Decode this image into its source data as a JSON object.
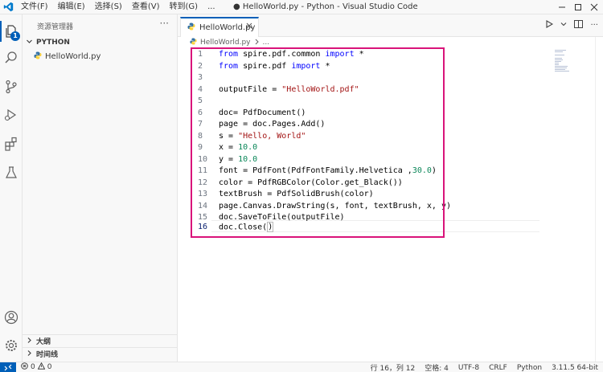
{
  "titlebar": {
    "menu": [
      "文件(F)",
      "编辑(E)",
      "选择(S)",
      "查看(V)",
      "转到(G)",
      "..."
    ],
    "title": "● HelloWorld.py - Python - Visual Studio Code"
  },
  "activity": {
    "explorer_badge": "1"
  },
  "sidebar": {
    "header": "资源管理器",
    "more": "···",
    "section": "PYTHON",
    "file": "HelloWorld.py",
    "outline": "大纲",
    "timeline": "时间线"
  },
  "editor": {
    "tab_label": "HelloWorld.py",
    "breadcrumb_file": "HelloWorld.py",
    "breadcrumb_more": "...",
    "actions_more": "···",
    "line_numbers": [
      "1",
      "2",
      "3",
      "4",
      "5",
      "6",
      "7",
      "8",
      "9",
      "10",
      "11",
      "12",
      "13",
      "14",
      "15",
      "16"
    ]
  },
  "code": {
    "l1_a": "from",
    "l1_b": " spire.pdf.common ",
    "l1_c": "import",
    "l1_d": " *",
    "l2_a": "from",
    "l2_b": " spire.pdf ",
    "l2_c": "import",
    "l2_d": " *",
    "l4_a": "outputFile = ",
    "l4_b": "\"HelloWorld.pdf\"",
    "l6": "doc= PdfDocument()",
    "l7": "page = doc.Pages.Add()",
    "l8_a": "s = ",
    "l8_b": "\"Hello, World\"",
    "l9_a": "x = ",
    "l9_b": "10.0",
    "l10_a": "y = ",
    "l10_b": "10.0",
    "l11_a": "font = PdfFont(PdfFontFamily.Helvetica ,",
    "l11_b": "30.0",
    "l11_c": ")",
    "l12": "color = PdfRGBColor(Color.get_Black())",
    "l13": "textBrush = PdfSolidBrush(color)",
    "l14": "page.Canvas.DrawString(s, font, textBrush, x, y)",
    "l15": "doc.SaveToFile(outputFile)",
    "l16_a": "doc.Close(",
    "l16_b": ")"
  },
  "status": {
    "errors": "0",
    "warnings": "0",
    "position": "行 16，列 12",
    "spaces": "空格: 4",
    "encoding": "UTF-8",
    "eol": "CRLF",
    "language": "Python",
    "interpreter": "3.11.5 64-bit"
  },
  "colors": {
    "accent": "#005fb8",
    "highlight_box": "#d9137a",
    "keyword": "#0000ff",
    "string": "#a31515",
    "number": "#098658"
  }
}
